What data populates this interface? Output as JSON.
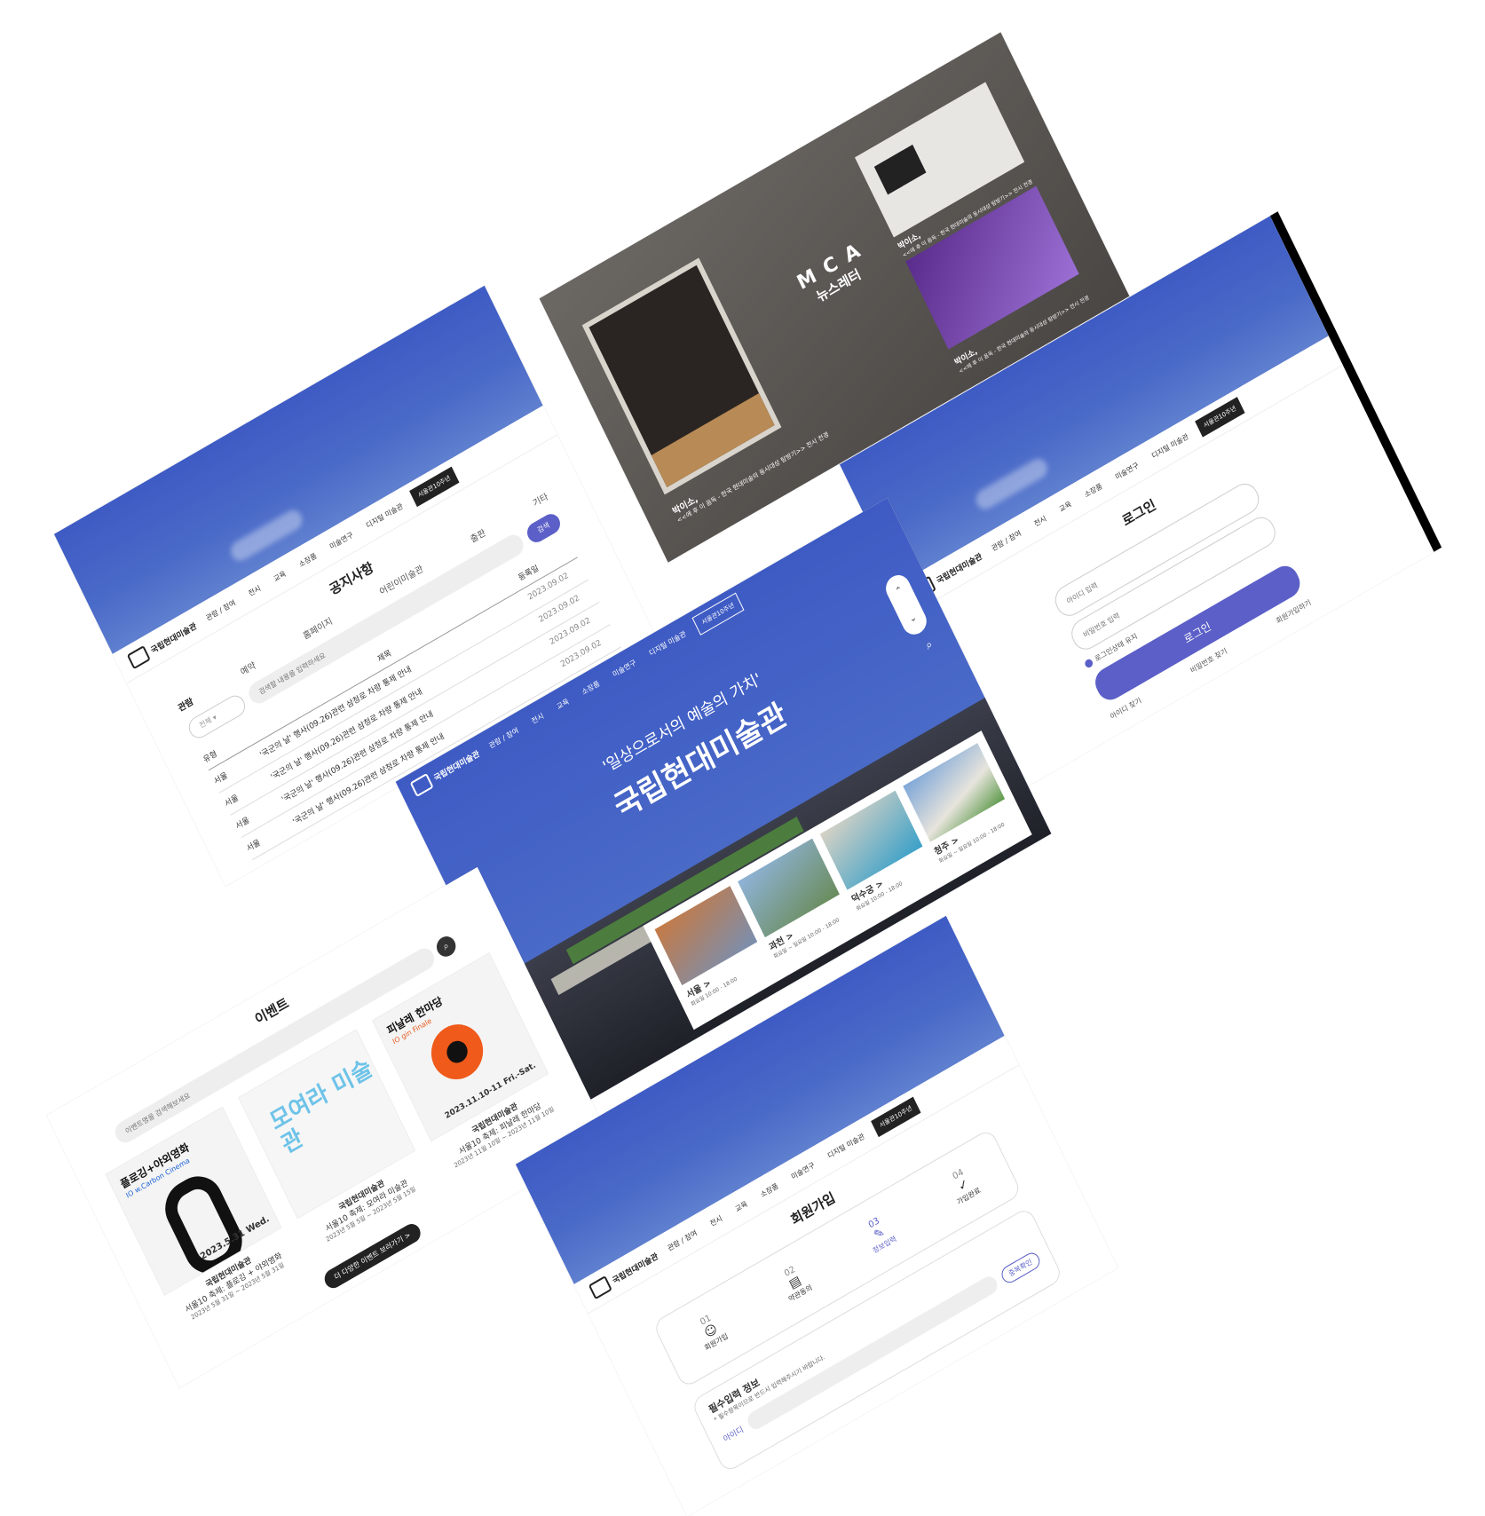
{
  "brand": {
    "name": "국립현대미술관",
    "anniversary_badge": "서울관10주년"
  },
  "nav": {
    "items": [
      "관람 / 참여",
      "전시",
      "교육",
      "소장품",
      "미술연구",
      "디지털 미술관"
    ]
  },
  "notice": {
    "title": "공지사항",
    "tabs": [
      "관람",
      "예약",
      "홈페이지",
      "어린이미술관",
      "출판",
      "기타"
    ],
    "select_value": "전체",
    "search_placeholder": "검색할 내용을 입력하세요",
    "search_button": "검색",
    "columns": [
      "유형",
      "제목",
      "등록일"
    ],
    "rows": [
      {
        "type": "서울",
        "title": "'국군의 날' 행사(09.26)관련 삼청로 차량 통제 안내",
        "date": "2023.09.02"
      },
      {
        "type": "서울",
        "title": "'국군의 날' 행사(09.26)관련 삼청로 차량 통제 안내",
        "date": "2023.09.02"
      },
      {
        "type": "서울",
        "title": "'국군의 날' 행사(09.26)관련 삼청로 차량 통제 안내",
        "date": "2023.09.02"
      },
      {
        "type": "서울",
        "title": "'국군의 날' 행사(09.26)관련 삼청로 차량 통제 안내",
        "date": "2023.09.02"
      }
    ]
  },
  "newsletter": {
    "title": "뉴스레터",
    "captions": [
      {
        "heading": "박이소,",
        "sub": "<<에 후 이 음독 - 한국 현대미술의 동시대성 탐방기>> 전시 전경"
      },
      {
        "heading": "박이소,",
        "sub": "<<에 후 이 음독 - 한국 현대미술의 동시대성 탐방기>> 전시 전경"
      },
      {
        "heading": "박이소,",
        "sub": "<<에 후 이 음독 - 한국 현대미술의 동시대성 탐방기>> 전시 전경"
      }
    ]
  },
  "login": {
    "title": "로그인",
    "id_placeholder": "아이디 입력",
    "pw_placeholder": "비밀번호 입력",
    "remember": "로그인상태 유지",
    "submit": "로그인",
    "links": [
      "아이디 찾기",
      "비밀번호 찾기",
      "회원가입하기"
    ]
  },
  "hero": {
    "tagline": "'일상으로서의 예술의 가치'",
    "heading": "국립현대미술관",
    "branches": [
      {
        "name": "서울 >",
        "hours": "화요일 10:00 - 18:00"
      },
      {
        "name": "과천 >",
        "hours": "화요일 ~ 일요일 10:00 - 18:00"
      },
      {
        "name": "덕수궁 >",
        "hours": "화요일 10:00 - 18:00"
      },
      {
        "name": "청주 >",
        "hours": "화요일 ~ 일요일 10:00 - 18:00"
      }
    ]
  },
  "events": {
    "title": "이벤트",
    "search_placeholder": "이벤트명을 검색해보세요",
    "more_button": "더 다양한 이벤트 보러가기 >",
    "cards": [
      {
        "poster_title": "플로깅+야외영화",
        "poster_sub": "IO w.Carbon Cinema",
        "poster_date": "2023.5.31 Wed.",
        "org": "국립현대미술관",
        "name": "서울10 축제: 플로깅 + 야외영화",
        "period": "2023년 5월 31일 ~ 2023년 5월 31일"
      },
      {
        "poster_title": "모여라 미술관",
        "poster_sub": "",
        "poster_date": "",
        "org": "국립현대미술관",
        "name": "서울10 축제: 모여라 미술관",
        "period": "2023년 5월 5일 ~ 2023년 5월 15일"
      },
      {
        "poster_title": "피날레 한마당",
        "poster_sub": "IO gin Finale",
        "poster_date": "2023.11.10-11 Fri.-Sat.",
        "org": "국립현대미술관",
        "name": "서울10 축제: 피날레 한마당",
        "period": "2023년 11월 10일 ~ 2023년 11월 10일"
      }
    ]
  },
  "signup": {
    "title": "회원가입",
    "steps": [
      {
        "num": "01",
        "label": "회원가입"
      },
      {
        "num": "02",
        "label": "약관동의"
      },
      {
        "num": "03",
        "label": "정보입력"
      },
      {
        "num": "04",
        "label": "가입완료"
      }
    ],
    "required_title": "필수입력 정보",
    "required_note": "* 필수항목이므로 반드시 입력해주시기 바랍니다.",
    "id_label": "아이디",
    "check_button": "중복확인"
  },
  "colors": {
    "sky": "#4a6ac8",
    "accent": "#5b5fc7",
    "dark": "#222222"
  }
}
